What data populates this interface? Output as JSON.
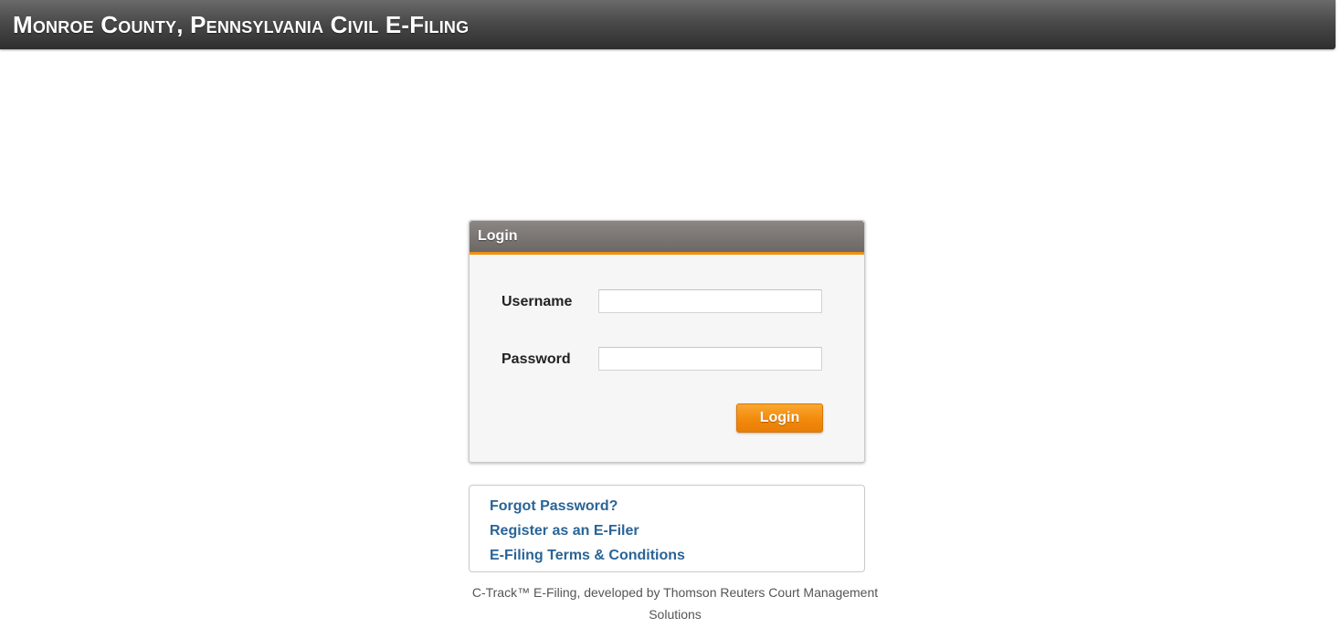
{
  "header": {
    "title": "Monroe County, Pennsylvania Civil E-Filing"
  },
  "login_panel": {
    "title": "Login",
    "username_label": "Username",
    "username_value": "",
    "password_label": "Password",
    "password_value": "",
    "submit_label": "Login"
  },
  "links": {
    "forgot_password": "Forgot Password?",
    "register": "Register as an E-Filer",
    "terms": "E-Filing Terms & Conditions"
  },
  "footer": {
    "text": "C-Track™ E-Filing, developed by Thomson Reuters Court Management Solutions"
  },
  "colors": {
    "header_bg": "#3a3a3a",
    "accent_orange": "#f28a0c",
    "link_blue": "#2a6496"
  }
}
